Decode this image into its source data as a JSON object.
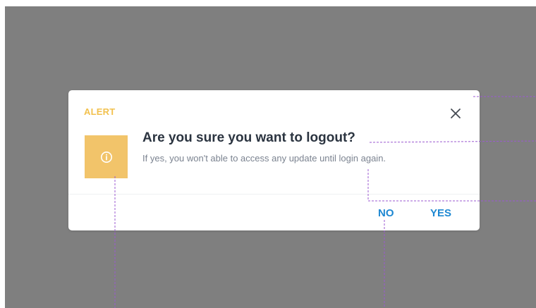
{
  "dialog": {
    "label": "ALERT",
    "title": "Are you sure you want to logout?",
    "message": "If yes, you won't able to access any update until login again.",
    "buttons": {
      "no": "NO",
      "yes": "YES"
    },
    "close_icon": "close-icon",
    "info_icon": "info-circle-icon"
  },
  "colors": {
    "backdrop": "#7f7f7f",
    "alert_accent": "#f2c14e",
    "icon_box": "#f2c46a",
    "button": "#1e88d2",
    "title": "#2b3440",
    "message": "#7b8390",
    "guide_lines": "#9b59d0"
  }
}
